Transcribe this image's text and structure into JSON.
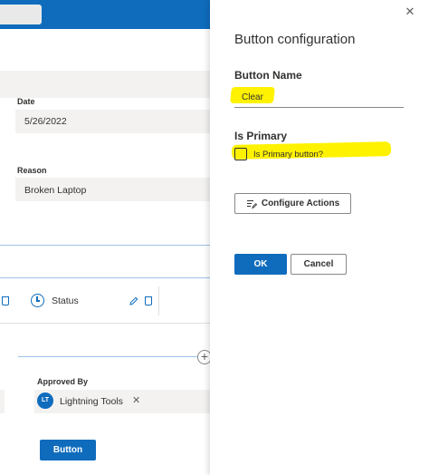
{
  "background": {
    "date_label": "Date",
    "date_value": "5/26/2022",
    "reason_label": "Reason",
    "reason_value": "Broken Laptop",
    "status_tab_label": "Status",
    "approved_by_label": "Approved By",
    "approver": {
      "initials": "LT",
      "name": "Lightning Tools"
    },
    "button_label": "Button"
  },
  "panel": {
    "title": "Button configuration",
    "button_name_label": "Button Name",
    "button_name_value": "Clear",
    "is_primary_label": "Is Primary",
    "is_primary_checkbox_label": "Is Primary button?",
    "is_primary_checked": false,
    "configure_actions_label": "Configure Actions",
    "ok_label": "OK",
    "cancel_label": "Cancel"
  },
  "colors": {
    "accent": "#0f6cbd",
    "highlight": "#fff200"
  },
  "icons": [
    "close-icon",
    "clock-icon",
    "edit-icon",
    "trash-icon",
    "add-icon",
    "remove-icon",
    "configure-actions-icon"
  ]
}
